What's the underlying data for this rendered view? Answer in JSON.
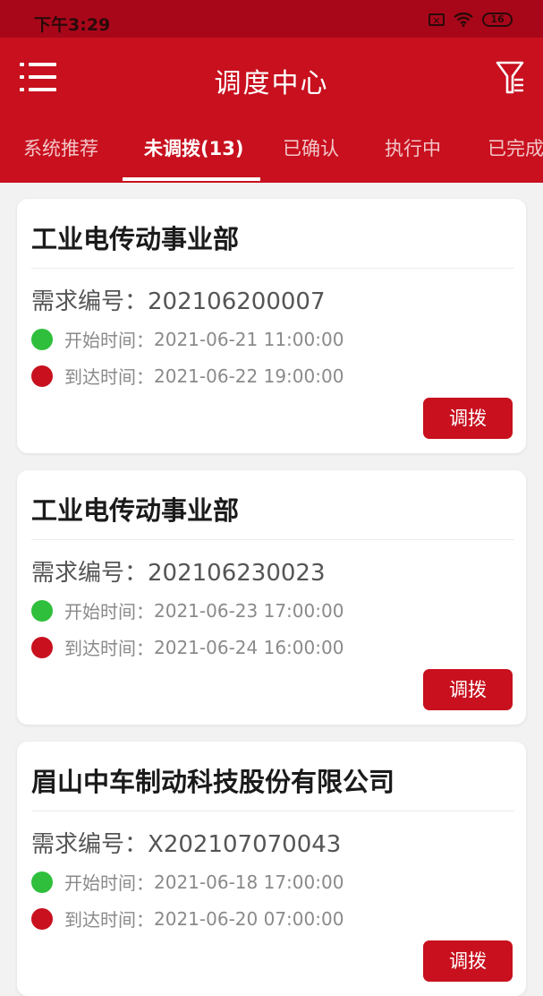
{
  "status_bar": {
    "time": "下午3:29",
    "battery": "16"
  },
  "header": {
    "title": "调度中心"
  },
  "tabs": [
    {
      "label": "系统推荐"
    },
    {
      "label": "未调拨(13)"
    },
    {
      "label": "已确认"
    },
    {
      "label": "执行中"
    },
    {
      "label": "已完成"
    }
  ],
  "cards": [
    {
      "company": "工业电传动事业部",
      "demand_label": "需求编号：",
      "demand_no": "202106200007",
      "start_label": "开始时间：",
      "start_time": "2021-06-21 11:00:00",
      "arrive_label": "到达时间：",
      "arrive_time": "2021-06-22 19:00:00",
      "button": "调拨"
    },
    {
      "company": "工业电传动事业部",
      "demand_label": "需求编号：",
      "demand_no": "202106230023",
      "start_label": "开始时间：",
      "start_time": "2021-06-23 17:00:00",
      "arrive_label": "到达时间：",
      "arrive_time": "2021-06-24 16:00:00",
      "button": "调拨"
    },
    {
      "company": "眉山中车制动科技股份有限公司",
      "demand_label": "需求编号：",
      "demand_no": "X202107070043",
      "start_label": "开始时间：",
      "start_time": "2021-06-18 17:00:00",
      "arrive_label": "到达时间：",
      "arrive_time": "2021-06-20 07:00:00",
      "button": "调拨"
    }
  ],
  "colors": {
    "primary": "#c8101e",
    "status_bar": "#a8071a",
    "start_dot": "#2fbf3c",
    "arrive_dot": "#c8101e"
  }
}
